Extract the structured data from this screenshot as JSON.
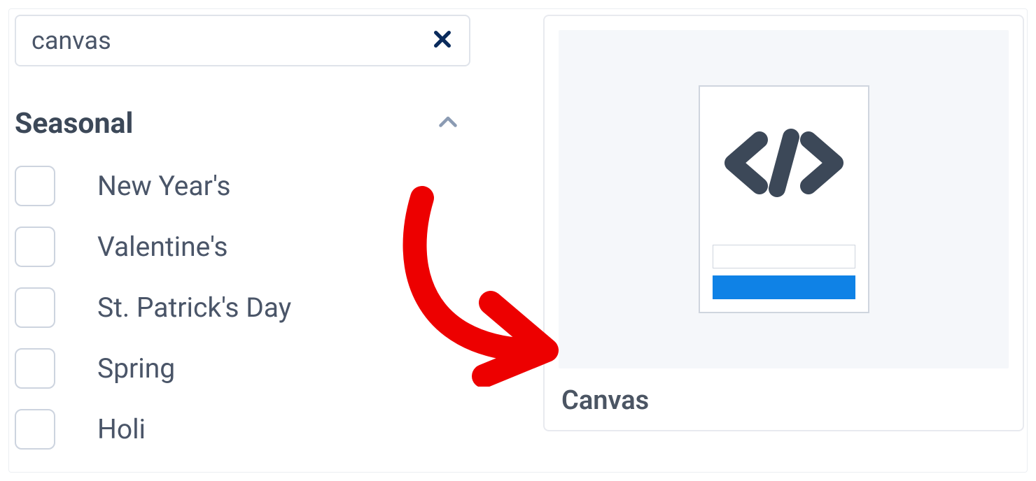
{
  "search": {
    "value": "canvas"
  },
  "category": {
    "title": "Seasonal",
    "items": [
      {
        "label": "New Year's"
      },
      {
        "label": "Valentine's"
      },
      {
        "label": "St. Patrick's Day"
      },
      {
        "label": "Spring"
      },
      {
        "label": "Holi"
      }
    ]
  },
  "template": {
    "label": "Canvas"
  },
  "colors": {
    "primary_blue": "#0f82e6",
    "text_dark": "#3c4858",
    "annotation_red": "#ed0000"
  }
}
